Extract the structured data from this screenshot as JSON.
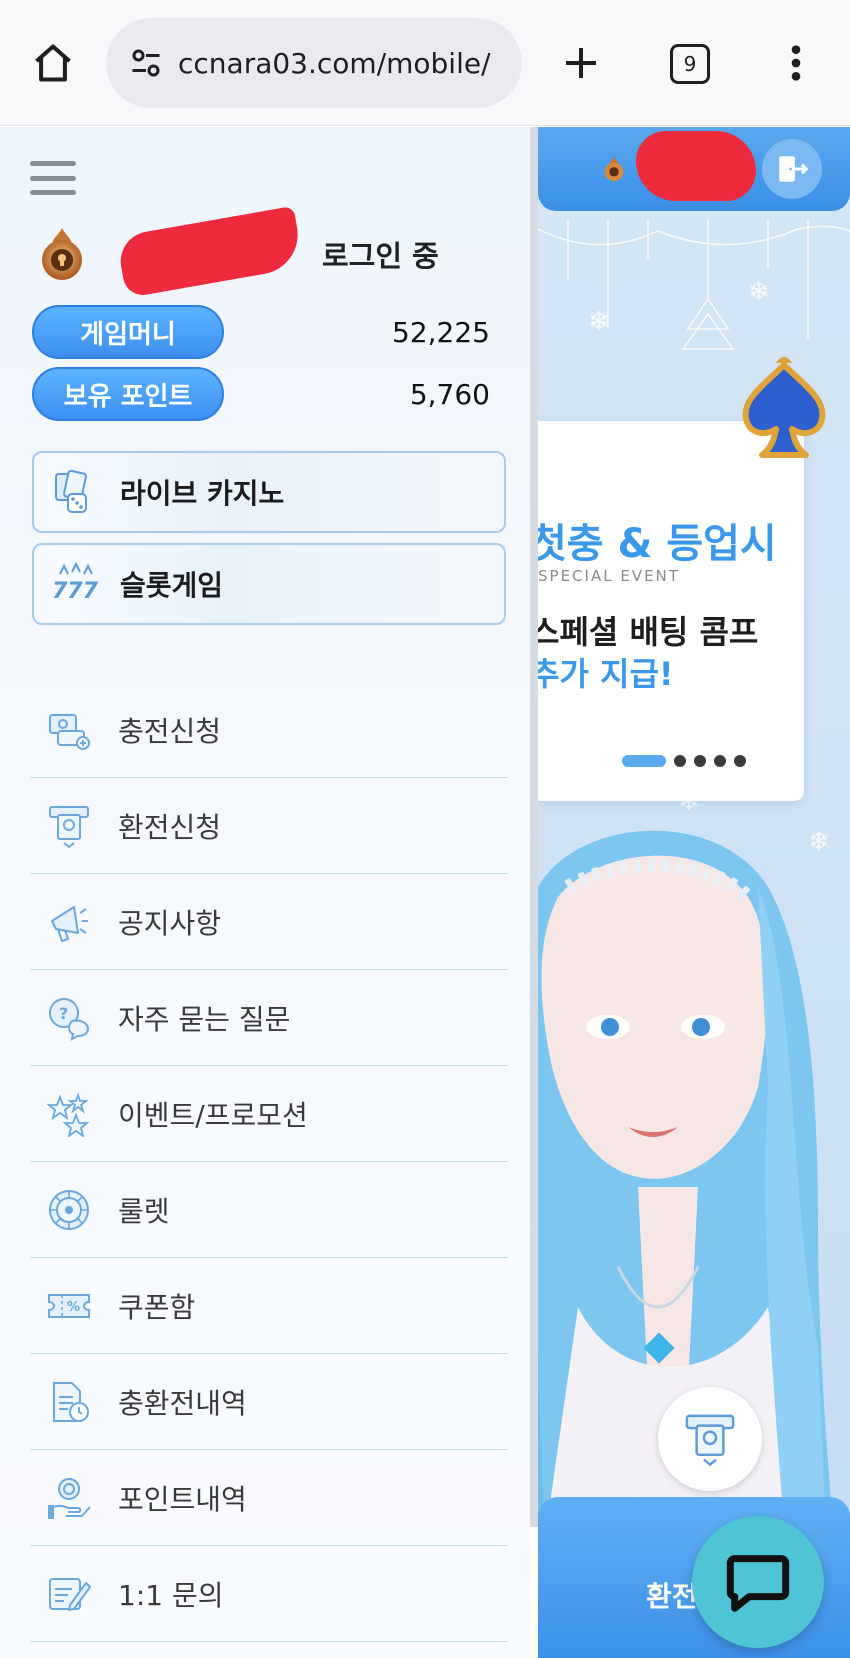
{
  "browser": {
    "url": "ccnara03.com/mobile/",
    "tab_count": "9"
  },
  "drawer": {
    "user_status": "로그인 중",
    "balances": [
      {
        "label": "게임머니",
        "value": "52,225"
      },
      {
        "label": "보유 포인트",
        "value": "5,760"
      }
    ],
    "featured": [
      {
        "label": "라이브 카지노",
        "icon": "cards-dice-icon"
      },
      {
        "label": "슬롯게임",
        "icon": "slot-777-icon"
      }
    ],
    "menu_items": [
      {
        "label": "충전신청",
        "icon": "deposit-icon"
      },
      {
        "label": "환전신청",
        "icon": "withdraw-atm-icon"
      },
      {
        "label": "공지사항",
        "icon": "megaphone-icon"
      },
      {
        "label": "자주 묻는 질문",
        "icon": "faq-bubble-icon"
      },
      {
        "label": "이벤트/프로모션",
        "icon": "stars-icon"
      },
      {
        "label": "룰렛",
        "icon": "roulette-icon"
      },
      {
        "label": "쿠폰함",
        "icon": "coupon-icon"
      },
      {
        "label": "충환전내역",
        "icon": "history-document-icon"
      },
      {
        "label": "포인트내역",
        "icon": "points-hand-icon"
      },
      {
        "label": "1:1 문의",
        "icon": "inquiry-notepad-icon"
      }
    ]
  },
  "page": {
    "banner": {
      "line1": "첫충 & 등업시",
      "line2": "SPECIAL EVENT",
      "line3": "스페셜 배팅 콤프",
      "line4": "추가 지급!"
    },
    "bottom_label": "환전신청"
  },
  "colors": {
    "accent": "#3d8ff0",
    "header_blue": "#3a8fe6",
    "chat_fab": "#4fc4d4"
  }
}
